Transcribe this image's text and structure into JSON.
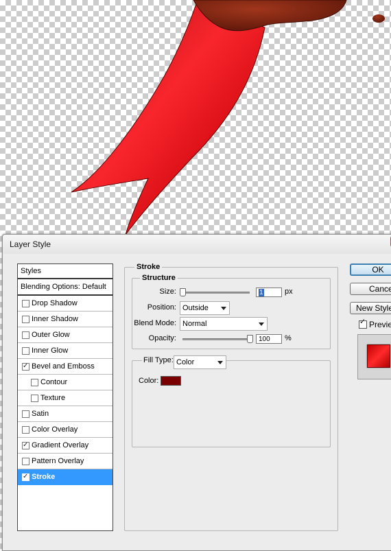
{
  "dialog": {
    "title": "Layer Style",
    "styles_header": "Styles",
    "blending_options": "Blending Options: Default",
    "effects": [
      {
        "label": "Drop Shadow",
        "checked": false,
        "indent": false
      },
      {
        "label": "Inner Shadow",
        "checked": false,
        "indent": false
      },
      {
        "label": "Outer Glow",
        "checked": false,
        "indent": false
      },
      {
        "label": "Inner Glow",
        "checked": false,
        "indent": false
      },
      {
        "label": "Bevel and Emboss",
        "checked": true,
        "indent": false
      },
      {
        "label": "Contour",
        "checked": false,
        "indent": true
      },
      {
        "label": "Texture",
        "checked": false,
        "indent": true
      },
      {
        "label": "Satin",
        "checked": false,
        "indent": false
      },
      {
        "label": "Color Overlay",
        "checked": false,
        "indent": false
      },
      {
        "label": "Gradient Overlay",
        "checked": true,
        "indent": false
      },
      {
        "label": "Pattern Overlay",
        "checked": false,
        "indent": false
      },
      {
        "label": "Stroke",
        "checked": true,
        "indent": false,
        "selected": true
      }
    ]
  },
  "stroke": {
    "section_title": "Stroke",
    "structure_title": "Structure",
    "size_label": "Size:",
    "size_value": "1",
    "size_unit": "px",
    "size_slider_fraction": 0.0,
    "position_label": "Position:",
    "position_value": "Outside",
    "blend_mode_label": "Blend Mode:",
    "blend_mode_value": "Normal",
    "opacity_label": "Opacity:",
    "opacity_value": "100",
    "opacity_unit": "%",
    "opacity_slider_fraction": 1.0,
    "fill_type_label": "Fill Type:",
    "fill_type_value": "Color",
    "color_label": "Color:",
    "color_value": "#7a0000"
  },
  "buttons": {
    "ok": "OK",
    "cancel": "Cancel",
    "new_style": "New Style...",
    "preview": "Preview"
  },
  "colors": {
    "ribbon": "#e5141c",
    "selection": "#3399ff"
  }
}
